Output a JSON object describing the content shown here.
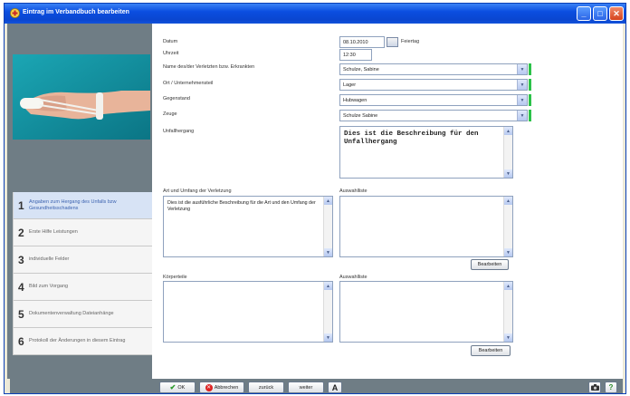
{
  "window": {
    "title": "Eintrag im Verbandbuch bearbeiten",
    "controls": [
      "_",
      "□",
      "✕"
    ]
  },
  "form": {
    "date_label": "Datum",
    "date_value": "08.10.2010",
    "holiday_label": "Feiertag",
    "time_label": "Uhrzeit",
    "time_value": "12:30",
    "injured_label": "Name des/der Verletzten bzw. Erkrankten",
    "injured_value": "Schulze, Sabine",
    "location_label": "Ort / Unternehmensteil",
    "location_value": "Lager",
    "object_label": "Gegenstand",
    "object_value": "Hubwagen",
    "witness_label": "Zeuge",
    "witness_value": "Schulze Sabine",
    "accident_label": "Unfallhergang",
    "accident_text": "Dies ist die Beschreibung für den Unfallhergang",
    "injury_label": "Art und Umfang der Verletzung",
    "injury_text": "Dies ist die ausführliche Beschreibung für die Art und den Umfang der Verletzung",
    "injury_list_label": "Auswahlliste",
    "injury_edit": "Bearbeiten",
    "body_label": "Körperteile",
    "body_list_label": "Auswahlliste",
    "body_edit": "Bearbeiten"
  },
  "steps": [
    {
      "num": "1",
      "label": "Angaben zum Hergang des Unfalls bzw Gesundheitsschadens"
    },
    {
      "num": "2",
      "label": "Erste Hilfe Leistungen"
    },
    {
      "num": "3",
      "label": "individuelle Felder"
    },
    {
      "num": "4",
      "label": "Bild zum Vorgang"
    },
    {
      "num": "5",
      "label": "Dokumentenverwaltung Dateianhänge"
    },
    {
      "num": "6",
      "label": "Protokoll der Änderungen in diesem Eintrag"
    }
  ],
  "bottom": {
    "ok": "OK",
    "cancel": "Abbrechen",
    "back": "zurück",
    "next": "weiter",
    "font": "A"
  },
  "colors": {
    "title_bar": "#0b4ee0",
    "panel": "#6f7d85",
    "required_marker": "#2cc24a",
    "active_step": "#3c63b0"
  }
}
